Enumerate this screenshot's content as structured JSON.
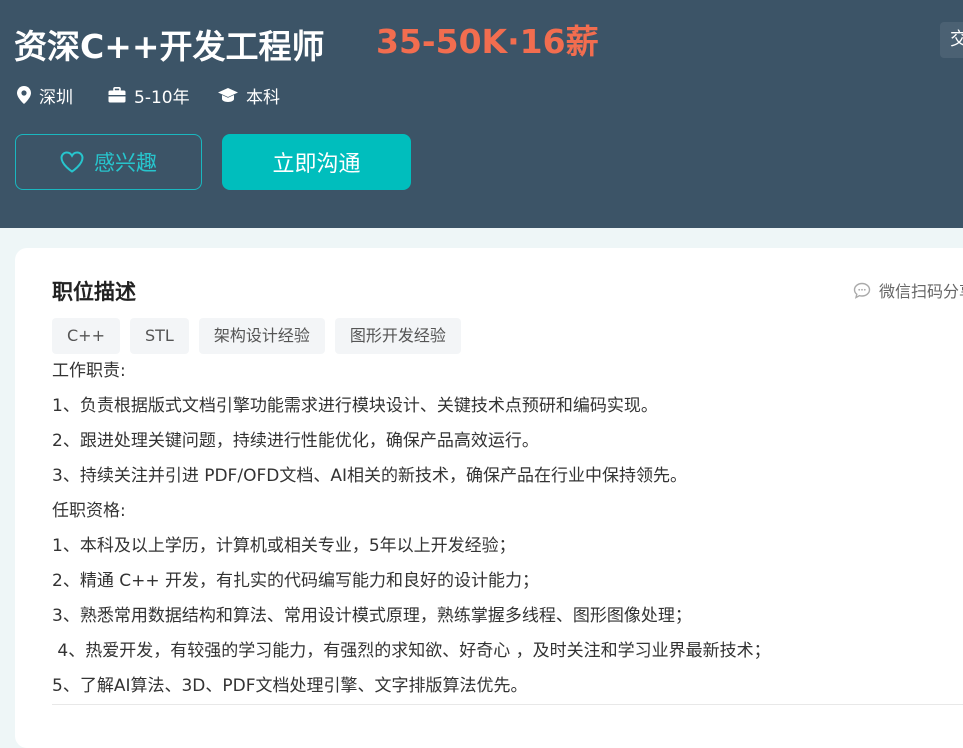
{
  "job": {
    "title": "资深C++开发工程师",
    "salary": "35-50K·16薪",
    "corner_label": "交",
    "meta": {
      "location": "深圳",
      "experience": "5-10年",
      "education": "本科"
    }
  },
  "actions": {
    "interest_label": "感兴趣",
    "chat_label": "立即沟通"
  },
  "description": {
    "section_title": "职位描述",
    "share_label": "微信扫码分享",
    "tags": [
      "C++",
      "STL",
      "架构设计经验",
      "图形开发经验"
    ],
    "lines": [
      "工作职责:",
      "1、负责根据版式文档引擎功能需求进行模块设计、关键技术点预研和编码实现。",
      "2、跟进处理关键问题，持续进行性能优化，确保产品高效运行。",
      "3、持续关注并引进 PDF/OFD文档、AI相关的新技术，确保产品在行业中保持领先。",
      "任职资格:",
      "1、本科及以上学历，计算机或相关专业，5年以上开发经验；",
      "2、精通 C++ 开发，有扎实的代码编写能力和良好的设计能力；",
      "3、熟悉常用数据结构和算法、常用设计模式原理，熟练掌握多线程、图形图像处理；",
      " 4、热爱开发，有较强的学习能力，有强烈的求知欲、好奇心 ，及时关注和学习业界最新技术；",
      "5、了解AI算法、3D、PDF文档处理引擎、文字排版算法优先。"
    ]
  },
  "colors": {
    "header_bg": "#3c5467",
    "salary": "#f26d4f",
    "accent": "#00bebd"
  },
  "icons": [
    "location-pin-icon",
    "briefcase-icon",
    "graduation-cap-icon",
    "heart-icon",
    "chat-bubble-icon"
  ]
}
